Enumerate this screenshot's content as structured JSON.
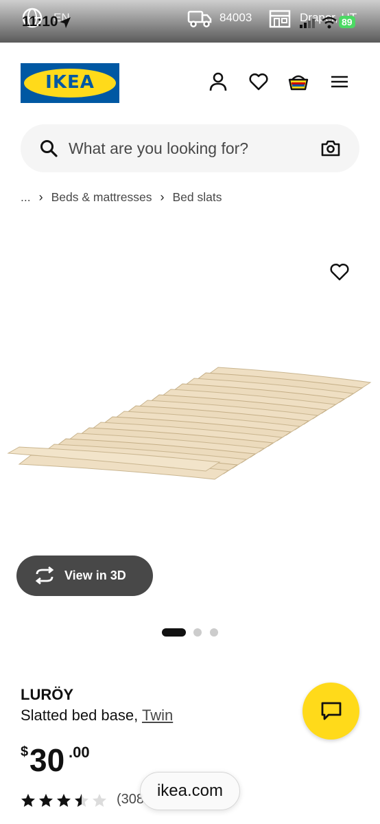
{
  "status_bar": {
    "language": "EN",
    "time": "11:10",
    "zip": "84003",
    "store": "Draper, UT",
    "battery": "89"
  },
  "header": {
    "logo_text": "IKEA",
    "icons": [
      "person-icon",
      "heart-icon",
      "basket-icon",
      "menu-icon"
    ]
  },
  "search": {
    "placeholder": "What are you looking for?"
  },
  "breadcrumb": {
    "ellipsis": "...",
    "items": [
      "Beds & mattresses",
      "Bed slats"
    ]
  },
  "media": {
    "view3d_label": "View in 3D",
    "carousel_count": 3,
    "carousel_active_index": 0
  },
  "product": {
    "name": "LURÖY",
    "description": "Slatted bed base,",
    "size": "Twin",
    "price_currency": "$",
    "price_whole": "30",
    "price_decimal": ".00",
    "rating": 3.5,
    "rating_max": 5,
    "review_count": "(308"
  },
  "browser": {
    "url": "ikea.com"
  },
  "colors": {
    "ikea_blue": "#0058a3",
    "ikea_yellow": "#ffda1a"
  }
}
